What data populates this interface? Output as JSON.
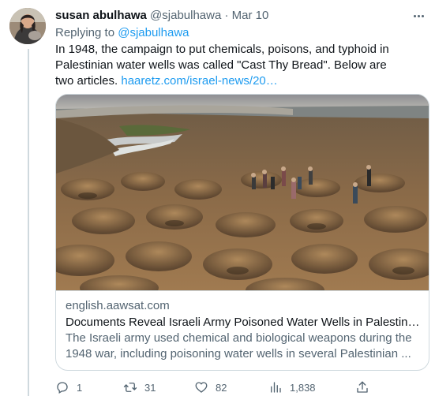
{
  "tweet": {
    "author_name": "susan abulhawa",
    "handle": "@sjabulhawa",
    "separator": "·",
    "date": "Mar 10",
    "replying_prefix": "Replying to",
    "replying_to": "@sjabulhawa",
    "text_body": "In 1948, the campaign to put chemicals, poisons, and typhoid in Palestinian water wells was called \"Cast Thy Bread\". Below are two articles. ",
    "text_link": "haaretz.com/israel-news/20…"
  },
  "card": {
    "domain": "english.aawsat.com",
    "title": "Documents Reveal Israeli Army Poisoned Water Wells in Palestinian ...",
    "description": "The Israeli army used chemical and biological weapons during the 1948 war, including poisoning water wells in several Palestinian ..."
  },
  "actions": {
    "replies": "1",
    "reposts": "31",
    "likes": "82",
    "views": "1,838"
  },
  "icons": {
    "reply": "reply-icon",
    "repost": "repost-icon",
    "like": "heart-icon",
    "views": "analytics-icon",
    "share": "share-icon",
    "more": "more-icon"
  },
  "colors": {
    "text": "#0f1419",
    "muted": "#536471",
    "link": "#1d9bf0",
    "border": "#cfd9de"
  }
}
